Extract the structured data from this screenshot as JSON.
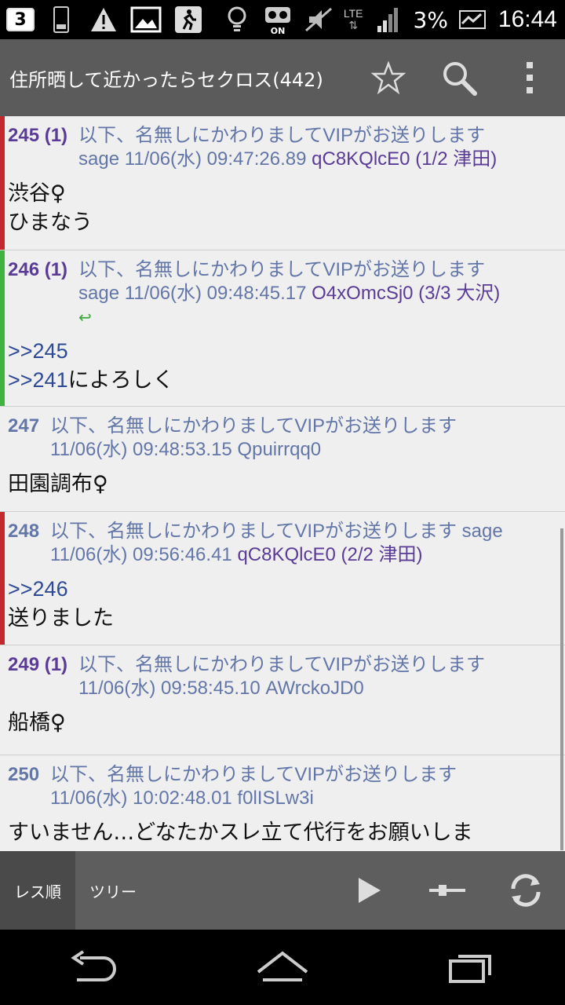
{
  "status_bar": {
    "notif_badge": "3",
    "lte": "LTE",
    "battery": "3%",
    "time": "16:44",
    "icons": [
      "sd-card-icon",
      "warning-icon",
      "image-icon",
      "runner-icon",
      "bulb-icon",
      "voicemail-icon",
      "mute-icon",
      "signal-icon",
      "battery-icon"
    ]
  },
  "action_bar": {
    "title": "住所晒して近かったらセクロス(442)",
    "icons": [
      "star-icon",
      "search-icon",
      "overflow-menu-icon"
    ]
  },
  "posts": [
    {
      "num": "245 (1)",
      "name": "以下、名無しにかわりましてVIPがお送りします",
      "meta": "sage 11/06(水) 09:47:26.89 ",
      "id": "qC8KQlcE0 (1/2 津田)",
      "bar_color": "#c3282d",
      "lines": [
        "渋谷♀",
        "ひまなう"
      ]
    },
    {
      "num": "246 (1)",
      "name": "以下、名無しにかわりましてVIPがお送りします",
      "meta": "sage 11/06(水) 09:48:45.17 ",
      "id": "O4xOmcSj0 (3/3 大沢)",
      "bar_color": "#3fb23f",
      "reply": "↩",
      "refs": [
        ">>245",
        ">>241"
      ],
      "ref_tail": "によろしく"
    },
    {
      "num": "247",
      "name": "以下、名無しにかわりましてVIPがお送りします",
      "meta": "11/06(水) 09:48:53.15 Qpuirrqq0",
      "lines": [
        "田園調布♀"
      ]
    },
    {
      "num": "248",
      "name": "以下、名無しにかわりましてVIPがお送りします sage",
      "meta": "11/06(水) 09:56:46.41 ",
      "id": "qC8KQlcE0 (2/2 津田)",
      "bar_color": "#c3282d",
      "ref": ">>246",
      "lines": [
        "送りました"
      ]
    },
    {
      "num": "249 (1)",
      "name": "以下、名無しにかわりましてVIPがお送りします",
      "meta": "11/06(水) 09:58:45.10 AWrckoJD0",
      "lines": [
        "船橋♀"
      ]
    },
    {
      "num": "250",
      "name": "以下、名無しにかわりましてVIPがお送りします",
      "meta": "11/06(水) 10:02:48.01 f0lISLw3i",
      "lines": [
        "すいません…どなたかスレ立て代行をお願いしま"
      ]
    }
  ],
  "tabs": {
    "active": "レス順",
    "other": "ツリー"
  },
  "tab_icons": [
    "play-icon",
    "slider-icon",
    "refresh-icon"
  ],
  "nav_icons": [
    "back-icon",
    "home-icon",
    "recent-apps-icon"
  ]
}
